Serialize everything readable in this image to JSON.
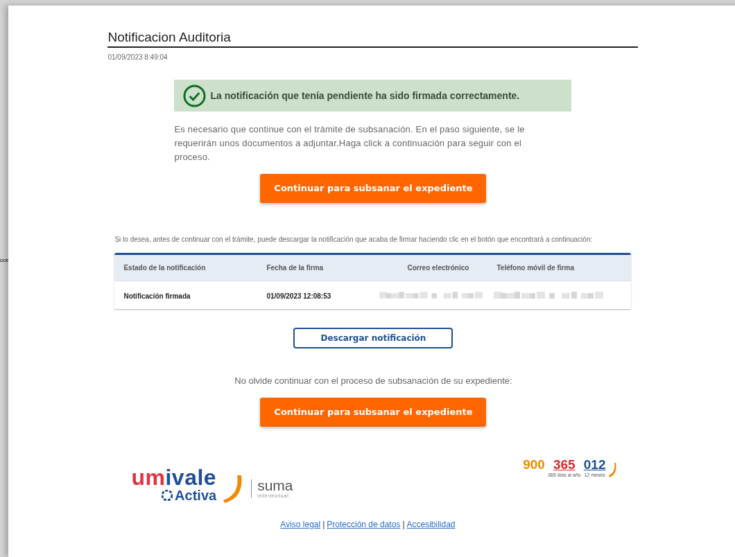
{
  "background": {
    "fragment": "cce"
  },
  "header": {
    "title": "Notificacion Auditoria",
    "timestamp": "01/09/2023 8:49:04"
  },
  "success_banner": {
    "message": "La notificación que tenía pendiente ha sido firmada correctamente."
  },
  "intro": "Es necesario que continue con el trámite de subsanación. En el paso siguiente, se le requerirán unos documentos a adjuntar.Haga click a continuación para seguir con el proceso.",
  "continue_button_top": "Continuar para subsanar el expediente",
  "download_hint": "Si lo desea, antes de continuar con el trámite, puede descargar la notificación que acaba de firmar haciendo clic en el botón que encontrará a continuación:",
  "table": {
    "columns": [
      "Estado de la notificación",
      "Fecha de la firma",
      "Correo electrónico",
      "Teléfono móvil de firma"
    ],
    "rows": [
      {
        "cells": [
          {
            "kind": "text",
            "text": "Notificación firmada"
          },
          {
            "kind": "text",
            "text": "01/09/2023 12:08:53"
          },
          {
            "kind": "redacted"
          },
          {
            "kind": "redacted"
          }
        ]
      }
    ]
  },
  "download_button": "Descargar notificación",
  "reminder": "No olvide continuar con el proceso de subsanación de su expediente:",
  "continue_button_bottom": "Continuar para subsanar el expediente",
  "footer": {
    "logo": {
      "name": "umivale",
      "sub": "Activa",
      "partner": "suma",
      "partner_sub": "intermutual"
    },
    "phone": {
      "parts": [
        "900",
        "365",
        "012"
      ],
      "captions": [
        "365 días al año",
        "12 meses"
      ]
    },
    "links": [
      "Aviso legal",
      "Protección de datos",
      "Accesibilidad"
    ],
    "separator": "|"
  }
}
